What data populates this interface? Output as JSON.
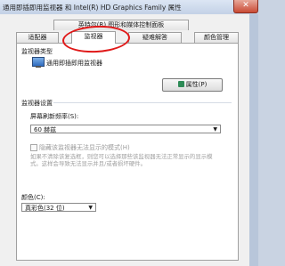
{
  "window": {
    "title": "通用即插即用监视器 和 Intel(R) HD Graphics Family 属性",
    "close_symbol": "✕"
  },
  "tabs": {
    "row1": [
      "英特尔(R) 图形和媒体控制面板"
    ],
    "row2": [
      "适配器",
      "监视器",
      "疑难解答",
      "颜色管理"
    ],
    "active": "监视器"
  },
  "monitor_type": {
    "group_label": "监视器类型",
    "name": "通用即插即用监视器",
    "properties_button": "属性(P)"
  },
  "monitor_settings": {
    "group_label": "监视器设置",
    "refresh_label": "屏幕刷新频率(S):",
    "refresh_value": "60 赫兹",
    "hide_modes_label": "隐藏该监视器无法显示的模式(H)",
    "hide_modes_description": "如果不清除该复选框，则您可以选择那些该监视器无法正常显示的显示模式。这样会导致无法显示并且/或者损坏硬件。",
    "color_label": "颜色(C):",
    "color_value": "真彩色(32 位)"
  }
}
